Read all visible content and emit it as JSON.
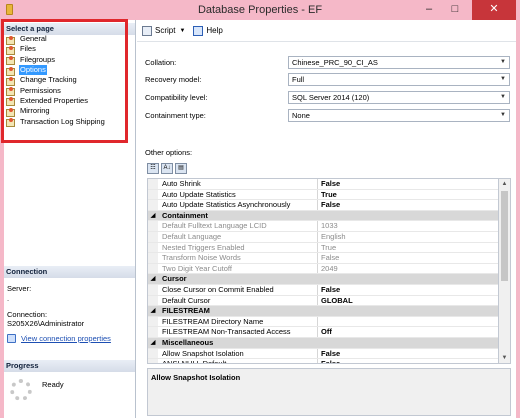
{
  "window": {
    "title": "Database Properties - EF",
    "minimize": "–",
    "maximize": "□",
    "close": "✕"
  },
  "left": {
    "select_header": "Select a page",
    "pages": [
      {
        "label": "General"
      },
      {
        "label": "Files"
      },
      {
        "label": "Filegroups"
      },
      {
        "label": "Options",
        "selected": true
      },
      {
        "label": "Change Tracking"
      },
      {
        "label": "Permissions"
      },
      {
        "label": "Extended Properties"
      },
      {
        "label": "Mirroring"
      },
      {
        "label": "Transaction Log Shipping"
      }
    ],
    "connection_header": "Connection",
    "server_label": "Server:",
    "server_value": ".",
    "connection_label": "Connection:",
    "connection_value": "S205X26\\Administrator",
    "view_link": "View connection properties",
    "progress_header": "Progress",
    "progress_status": "Ready"
  },
  "toolbar": {
    "script_label": "Script",
    "script_arrow": "▼",
    "help_label": "Help"
  },
  "fields": [
    {
      "label": "Collation:",
      "value": "Chinese_PRC_90_CI_AS"
    },
    {
      "label": "Recovery model:",
      "value": "Full"
    },
    {
      "label": "Compatibility level:",
      "value": "SQL Server 2014 (120)"
    },
    {
      "label": "Containment type:",
      "value": "None"
    }
  ],
  "other_options_label": "Other options:",
  "sort_buttons": {
    "categorized": "☷",
    "alphabetical": "A↓",
    "pages": "▤"
  },
  "grid": {
    "rows": [
      {
        "kind": "prop",
        "name": "Auto Shrink",
        "value": "False"
      },
      {
        "kind": "prop",
        "name": "Auto Update Statistics",
        "value": "True"
      },
      {
        "kind": "prop",
        "name": "Auto Update Statistics Asynchronously",
        "value": "False"
      },
      {
        "kind": "cat",
        "name": "Containment"
      },
      {
        "kind": "disabled",
        "name": "Default Fulltext Language LCID",
        "value": "1033"
      },
      {
        "kind": "disabled",
        "name": "Default Language",
        "value": "English"
      },
      {
        "kind": "disabled",
        "name": "Nested Triggers Enabled",
        "value": "True"
      },
      {
        "kind": "disabled",
        "name": "Transform Noise Words",
        "value": "False"
      },
      {
        "kind": "disabled",
        "name": "Two Digit Year Cutoff",
        "value": "2049"
      },
      {
        "kind": "cat",
        "name": "Cursor"
      },
      {
        "kind": "prop",
        "name": "Close Cursor on Commit Enabled",
        "value": "False"
      },
      {
        "kind": "prop",
        "name": "Default Cursor",
        "value": "GLOBAL"
      },
      {
        "kind": "cat",
        "name": "FILESTREAM"
      },
      {
        "kind": "prop",
        "name": "FILESTREAM Directory Name",
        "value": ""
      },
      {
        "kind": "prop",
        "name": "FILESTREAM Non-Transacted Access",
        "value": "Off"
      },
      {
        "kind": "cat",
        "name": "Miscellaneous"
      },
      {
        "kind": "prop",
        "name": "Allow Snapshot Isolation",
        "value": "False"
      },
      {
        "kind": "prop",
        "name": "ANSI NULL Default",
        "value": "False"
      }
    ]
  },
  "description": "Allow Snapshot Isolation"
}
